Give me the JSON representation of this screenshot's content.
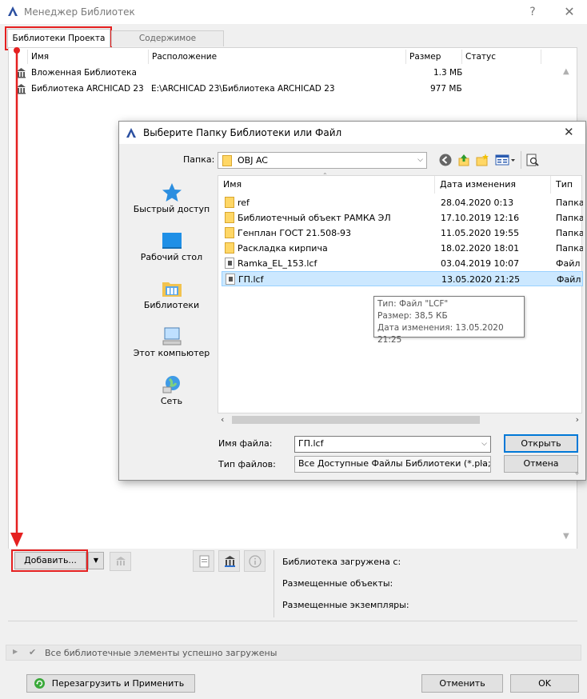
{
  "window": {
    "title": "Менеджер Библиотек",
    "help": "?",
    "close": "✕"
  },
  "tabs": [
    {
      "label": "Библиотеки Проекта"
    },
    {
      "label": "Содержимое Библиотеки"
    }
  ],
  "libraries": {
    "columns": [
      "Имя",
      "Расположение",
      "Размер",
      "Статус"
    ],
    "rows": [
      {
        "name": "Вложенная Библиотека",
        "location": "",
        "size": "1.3 МБ",
        "status": ""
      },
      {
        "name": "Библиотека ARCHICAD 23",
        "location": "E:\\ARCHICAD 23\\Библиотека ARCHICAD 23",
        "size": "977 МБ",
        "status": ""
      }
    ]
  },
  "add_button": "Добавить...",
  "info": {
    "loaded_label": "Библиотека загружена с:",
    "placed_objects": "Размещенные объекты:",
    "placed_instances": "Размещенные экземпляры:"
  },
  "status_message": "Все библиотечные элементы успешно загружены",
  "footer": {
    "reload_apply": "Перезагрузить и Применить",
    "cancel": "Отменить",
    "ok": "OK"
  },
  "dialog": {
    "title": "Выберите Папку Библиотеки или Файл",
    "close": "✕",
    "folder_label": "Папка:",
    "folder_value": "OBJ AC",
    "nav": [
      {
        "label": "Быстрый доступ"
      },
      {
        "label": "Рабочий стол"
      },
      {
        "label": "Библиотеки"
      },
      {
        "label": "Этот компьютер"
      },
      {
        "label": "Сеть"
      }
    ],
    "columns": [
      "Имя",
      "Дата изменения",
      "Тип"
    ],
    "files": [
      {
        "name": "ref",
        "date": "28.04.2020 0:13",
        "type": "Папка",
        "kind": "folder"
      },
      {
        "name": "Библиотечный объект РАМКА ЭЛ",
        "date": "17.10.2019 12:16",
        "type": "Папка",
        "kind": "folder"
      },
      {
        "name": "Генплан ГОСТ 21.508-93",
        "date": "11.05.2020 19:55",
        "type": "Папка",
        "kind": "folder"
      },
      {
        "name": "Раскладка кирпича",
        "date": "18.02.2020 18:01",
        "type": "Папка",
        "kind": "folder"
      },
      {
        "name": "Ramka_EL_153.lcf",
        "date": "03.04.2019 10:07",
        "type": "Файл",
        "kind": "file"
      },
      {
        "name": "ГП.lcf",
        "date": "13.05.2020 21:25",
        "type": "Файл",
        "kind": "file",
        "selected": true
      }
    ],
    "tooltip": {
      "type": "Тип: Файл \"LCF\"",
      "size": "Размер: 38,5 КБ",
      "date": "Дата изменения: 13.05.2020 21:25"
    },
    "filename_label": "Имя файла:",
    "filename_value": "ГП.lcf",
    "filetype_label": "Тип файлов:",
    "filetype_value": "Все Доступные Файлы Библиотеки (*.pla; *.",
    "open": "Открыть",
    "cancel": "Отмена"
  },
  "colors": {
    "annotation_red": "#e52020",
    "selection": "#cce8ff",
    "accent": "#0078d7"
  }
}
